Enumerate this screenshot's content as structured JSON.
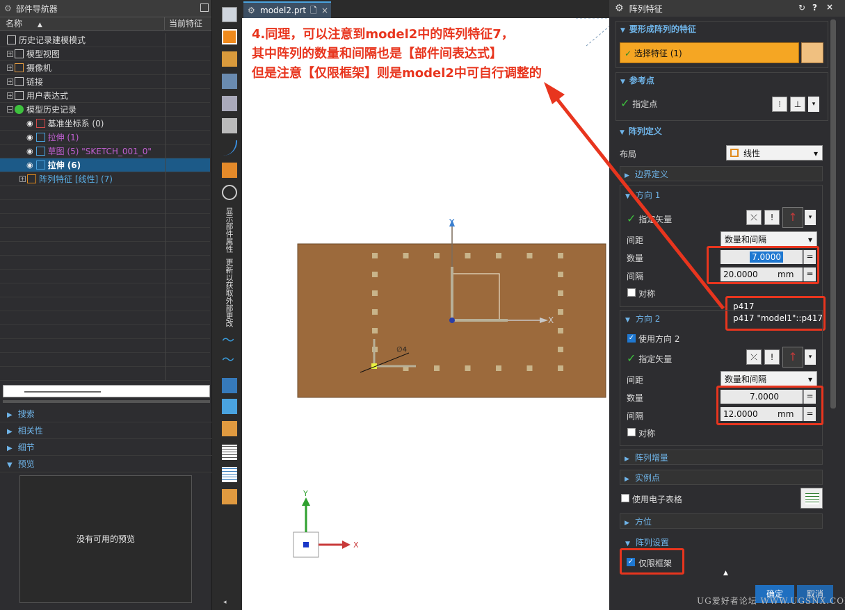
{
  "navigator": {
    "title": "部件导航器",
    "col_name": "名称",
    "col_current": "当前特征",
    "rows": [
      {
        "label": "历史记录建模模式",
        "color": "#dddddd"
      },
      {
        "label": "模型视图",
        "color": "#dddddd"
      },
      {
        "label": "摄像机",
        "color": "#dddddd"
      },
      {
        "label": "链接",
        "color": "#dddddd"
      },
      {
        "label": "用户表达式",
        "color": "#dddddd"
      },
      {
        "label": "模型历史记录",
        "color": "#dddddd"
      },
      {
        "label": "基准坐标系 (0)",
        "color": "#dddddd"
      },
      {
        "label": "拉伸 (1)",
        "color": "#c05fd0"
      },
      {
        "label": "草图 (5) \"SKETCH_001_0\"",
        "color": "#c05fd0"
      },
      {
        "label": "拉伸 (6)",
        "color": "#ffffff"
      },
      {
        "label": "阵列特征 [线性] (7)",
        "color": "#5ab0e8"
      }
    ],
    "sections": [
      "搜索",
      "相关性",
      "细节",
      "预览"
    ],
    "preview_text": "没有可用的预览"
  },
  "toolbar": {
    "vertical_label_1": "显示部件属性",
    "vertical_label_2": "更新以获取外部更改"
  },
  "tab": {
    "label": "model2.prt"
  },
  "annotation": {
    "line1": "4.同理，可以注意到model2中的阵列特征7，",
    "line2": "其中阵列的数量和间隔也是【部件间表达式】",
    "line3": "但是注意【仅限框架】则是model2中可自行调整的"
  },
  "viewport": {
    "axis_x": "X",
    "axis_y": "Y",
    "dim_label": "∅4",
    "triad_x": "X",
    "triad_y": "Y"
  },
  "tooltip": {
    "line1": "p417",
    "line2": "p417  \"model1\"::p417"
  },
  "dialog": {
    "title": "阵列特征",
    "features_group": "要形成阵列的特征",
    "select_feature": "选择特征 (1)",
    "ref_point_group": "参考点",
    "specify_point": "指定点",
    "pattern_def_group": "阵列定义",
    "layout_label": "布局",
    "layout_value": "线性",
    "boundary_def": "边界定义",
    "dir1": {
      "title": "方向 1",
      "vector": "指定矢量",
      "spacing_label": "间距",
      "spacing_value": "数量和间隔",
      "count_label": "数量",
      "count_value": "7.0000",
      "pitch_label": "间隔",
      "pitch_value": "20.0000",
      "unit": "mm",
      "symmetric": "对称"
    },
    "dir2": {
      "title": "方向 2",
      "use_dir2": "使用方向 2",
      "vector": "指定矢量",
      "spacing_label": "间距",
      "spacing_value": "数量和间隔",
      "count_label": "数量",
      "count_value": "7.0000",
      "pitch_label": "间隔",
      "pitch_value": "12.0000",
      "unit": "mm",
      "symmetric": "对称"
    },
    "increment": "阵列增量",
    "instance_point": "实例点",
    "use_spreadsheet": "使用电子表格",
    "orientation": "方位",
    "settings_group": "阵列设置",
    "frame_only": "仅限框架",
    "ok": "确定",
    "cancel": "取消"
  },
  "watermark": "UG爱好者论坛 WWW.UGSNX.COM",
  "colors": {
    "accent": "#e8351e",
    "selection": "#f5a623",
    "plate": "#9c6a3c"
  }
}
